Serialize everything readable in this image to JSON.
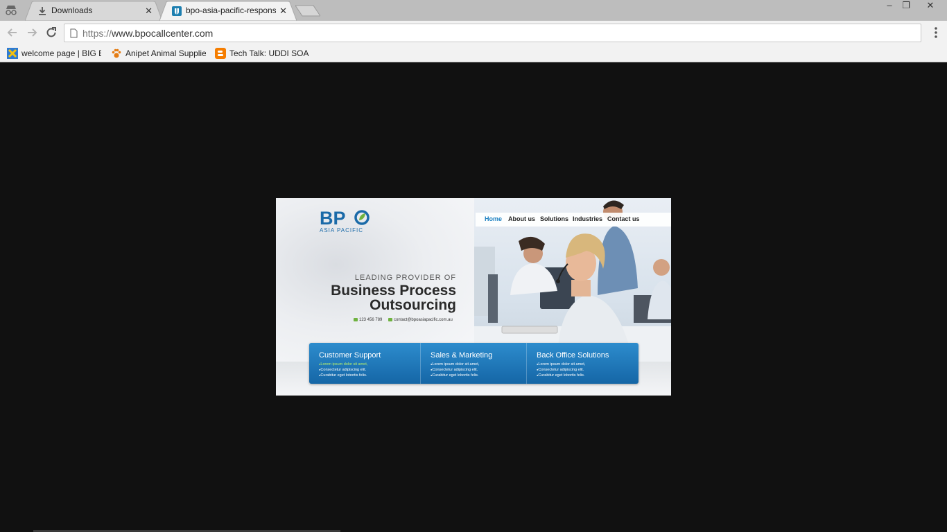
{
  "browser": {
    "tabs": [
      {
        "title": "Downloads",
        "active": false,
        "close": "✕"
      },
      {
        "title": "bpo-asia-pacific-respons",
        "active": true,
        "close": "✕"
      }
    ],
    "window_controls": {
      "minimize": "‒",
      "restore": "❐",
      "close": "✕"
    },
    "address": {
      "scheme": "https://",
      "host": "www.bpocallcenter.com"
    },
    "bookmarks": [
      {
        "label": "welcome page | BIG B",
        "icon": "x-logo-icon",
        "color": "#2e7bd1"
      },
      {
        "label": "Anipet Animal Supplie",
        "icon": "paw-icon",
        "color": "#e57c13"
      },
      {
        "label": "Tech Talk: UDDI SOA I",
        "icon": "blogger-icon",
        "color": "#f57d00"
      }
    ]
  },
  "site": {
    "logo": {
      "letters": "BP",
      "subtitle": "ASIA PACIFIC"
    },
    "nav": [
      "Home",
      "About us",
      "Solutions",
      "Industries",
      "Contact us"
    ],
    "tagline": {
      "kicker": "LEADING PROVIDER OF",
      "line1": "Business Process",
      "line2": "Outsourcing"
    },
    "contact": {
      "phone": "123 456 789",
      "email": "contact@bpoasiapacific.com.au"
    },
    "columns": [
      {
        "title": "Customer Support",
        "items": [
          "Lorem ipsum dolor sit amet,",
          "Consectetur adipiscing elit.",
          "Curabitur eget lobortis felis."
        ]
      },
      {
        "title": "Sales & Marketing",
        "items": [
          "Lorem ipsum dolor sit amet,",
          "Consectetur adipiscing elit.",
          "Curabitur eget lobortis felis."
        ]
      },
      {
        "title": "Back Office Solutions",
        "items": [
          "Lorem ipsum dolor sit amet,",
          "Consectetur adipiscing elit.",
          "Curabitur eget lobortis felis."
        ]
      }
    ],
    "accent": "#1a7fc1",
    "highlight": "#b9f06a"
  }
}
